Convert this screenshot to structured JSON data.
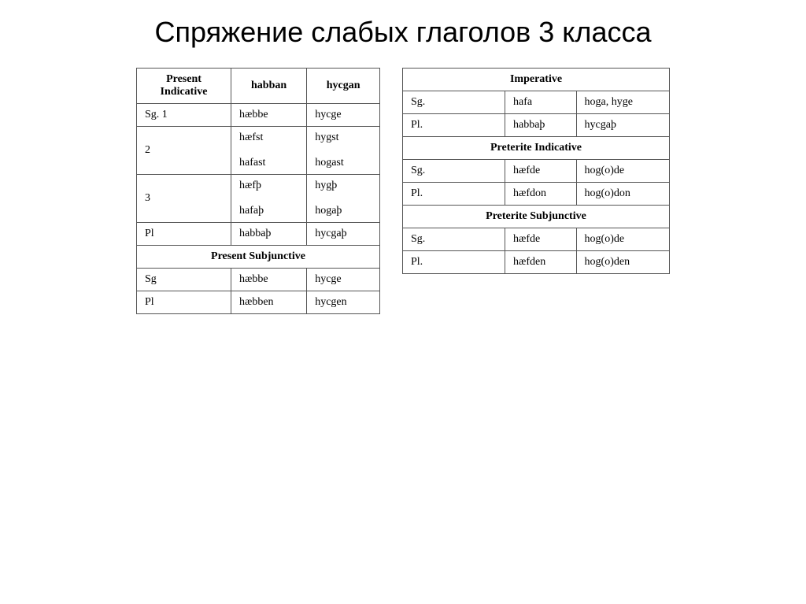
{
  "title": "Спряжение слабых глаголов 3 класса",
  "left_table": {
    "headers": [
      "Present Indicative",
      "habban",
      "hycgan"
    ],
    "rows": [
      {
        "label": "Sg. 1",
        "col1": "hæbbe",
        "col2": "hycge"
      },
      {
        "label": "2",
        "col1": "hæfst\n\nhafast",
        "col2": "hygst\n\nhogast"
      },
      {
        "label": "3",
        "col1": "hæfþ\n\nhafaþ",
        "col2": "hygþ\n\nhogaþ"
      },
      {
        "label": "Pl",
        "col1": "habbaþ",
        "col2": "hycgaþ"
      }
    ],
    "subjunctive_header": "Present Subjunctive",
    "subjunctive_rows": [
      {
        "label": "Sg",
        "col1": "hæbbe",
        "col2": "hycge"
      },
      {
        "label": "Pl",
        "col1": "hæbben",
        "col2": "hycgen"
      }
    ]
  },
  "right_table": {
    "imperative_header": "Imperative",
    "imperative_rows": [
      {
        "label": "Sg.",
        "col1": "hafa",
        "col2": "hoga, hyge"
      },
      {
        "label": "Pl.",
        "col1": "habbaþ",
        "col2": "hycgaþ"
      }
    ],
    "preterite_indicative_header": "Preterite Indicative",
    "preterite_indicative_rows": [
      {
        "label": "Sg.",
        "col1": "hæfde",
        "col2": "hog(o)de"
      },
      {
        "label": "Pl.",
        "col1": "hæfdon",
        "col2": "hog(o)don"
      }
    ],
    "preterite_subjunctive_header": "Preterite Subjunctive",
    "preterite_subjunctive_rows": [
      {
        "label": "Sg.",
        "col1": "hæfde",
        "col2": "hog(o)de"
      },
      {
        "label": "Pl.",
        "col1": "hæfden",
        "col2": "hog(o)den"
      }
    ]
  }
}
